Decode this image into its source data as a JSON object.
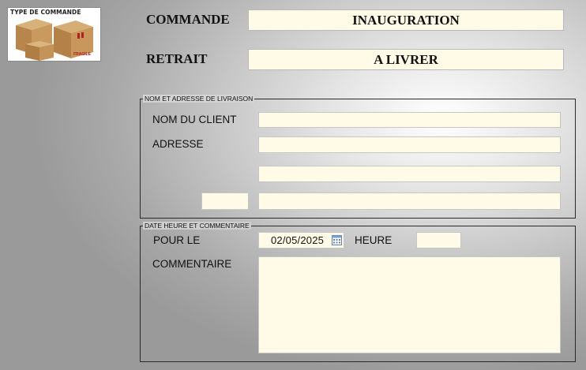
{
  "logo": {
    "title": "TYPE DE COMMANDE",
    "box_text": "FRAGILE",
    "icon": "cardboard-boxes-icon"
  },
  "commande": {
    "label": "COMMANDE",
    "value": "INAUGURATION"
  },
  "retrait": {
    "label": "RETRAIT",
    "value": "A LIVRER"
  },
  "delivery_group": {
    "title": "NOM ET ADRESSE DE LIVRAISON",
    "client_label": "NOM DU CLIENT",
    "client_value": "",
    "address_label": "ADRESSE",
    "address_line1": "",
    "address_line2": "",
    "postal_code": "",
    "city": ""
  },
  "datetime_group": {
    "title": "DATE HEURE ET COMMENTAIRE",
    "date_label": "POUR LE",
    "date_value": "02/05/2025",
    "time_label": "HEURE",
    "time_value": "",
    "comment_label": "COMMENTAIRE",
    "comment_value": ""
  },
  "colors": {
    "field_bg": "#fffbe6",
    "border": "#2a2a2a"
  }
}
